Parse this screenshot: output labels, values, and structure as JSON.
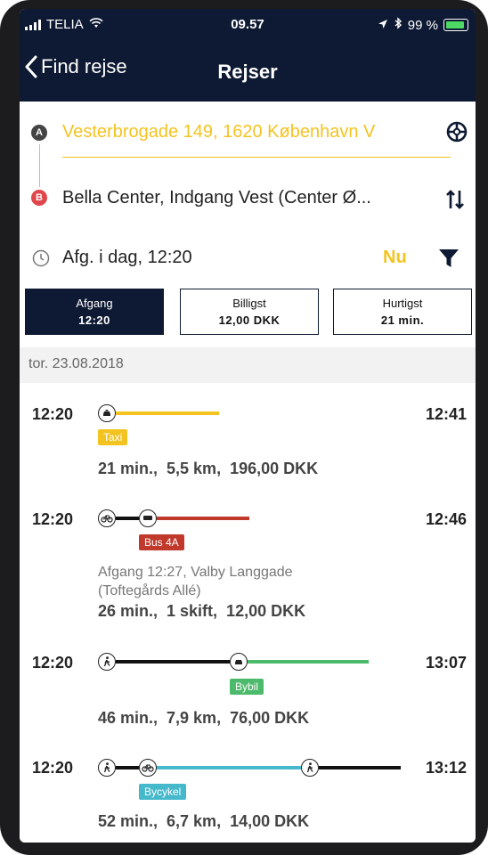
{
  "status": {
    "carrier": "TELIA",
    "time": "09.57",
    "battery": "99 %"
  },
  "nav": {
    "back_label": "Find rejse",
    "title": "Rejser"
  },
  "search": {
    "from": "Vesterbrogade 149, 1620 København V",
    "to": "Bella Center, Indgang Vest (Center Ø...",
    "time": "Afg. i dag, 12:20",
    "now_label": "Nu",
    "from_marker": "A",
    "to_marker": "B"
  },
  "tabs": [
    {
      "label": "Afgang",
      "value": "12:20",
      "active": true
    },
    {
      "label": "Billigst",
      "value": "12,00 DKK"
    },
    {
      "label": "Hurtigst",
      "value": "21 min."
    }
  ],
  "date": "tor. 23.08.2018",
  "colors": {
    "accent": "#f3c320",
    "navy": "#0e1a33",
    "taxi": "#f3c320",
    "bus": "#c0392b",
    "bybil": "#4cba6b",
    "bycykel": "#45b8cc"
  },
  "trips": [
    {
      "dep": "12:20",
      "arr": "12:41",
      "badge": "Taxi",
      "summary": "21 min.,  5,5 km,  196,00 DKK"
    },
    {
      "dep": "12:20",
      "arr": "12:46",
      "badge": "Bus 4A",
      "note1": "Afgang 12:27, Valby Langgade",
      "note2": "(Toftegårds Allé)",
      "summary": "26 min.,  1 skift,  12,00 DKK"
    },
    {
      "dep": "12:20",
      "arr": "13:07",
      "badge": "Bybil",
      "summary": "46 min.,  7,9 km,  76,00 DKK"
    },
    {
      "dep": "12:20",
      "arr": "13:12",
      "badge": "Bycykel",
      "summary": "52 min.,  6,7 km,  14,00 DKK"
    }
  ]
}
